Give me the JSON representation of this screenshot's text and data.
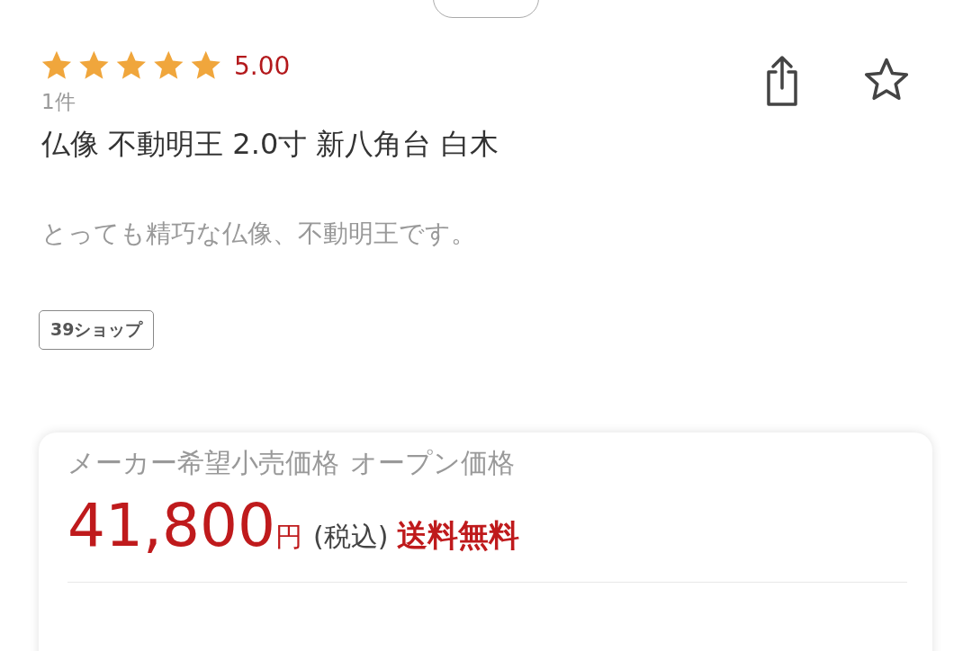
{
  "rating": {
    "stars": 5,
    "score": "5.00",
    "count": "1件"
  },
  "title": "仏像 不動明王 2.0寸 新八角台 白木",
  "description": "とっても精巧な仏像、不動明王です。",
  "shop_tag": "39ショップ",
  "price_card": {
    "list_price_label": "メーカー希望小売価格",
    "list_price_value": "オープン価格",
    "price": "41,800",
    "currency": "円",
    "tax_note": "(税込)",
    "shipping": "送料無料"
  }
}
